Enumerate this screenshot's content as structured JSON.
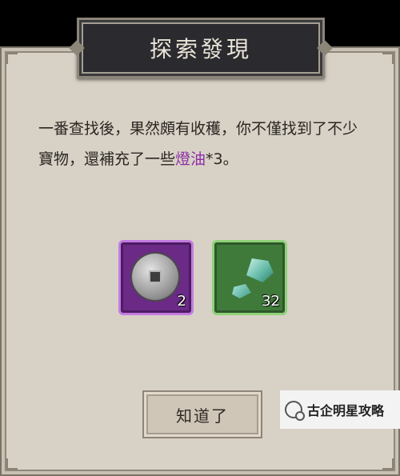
{
  "dialog": {
    "title": "探索發現",
    "message_before": "一番查找後，果然頗有收穫，你不僅找到了不少寶物，還補充了一些",
    "highlight": "燈油",
    "message_after": "*3。",
    "confirm_label": "知道了"
  },
  "rewards": [
    {
      "icon": "copper-coin-icon",
      "count": "2",
      "rarity_color": "#6a2a86"
    },
    {
      "icon": "jade-ore-icon",
      "count": "32",
      "rarity_color": "#3f7a3a"
    }
  ],
  "watermark": {
    "text": "古企明星攻略"
  }
}
